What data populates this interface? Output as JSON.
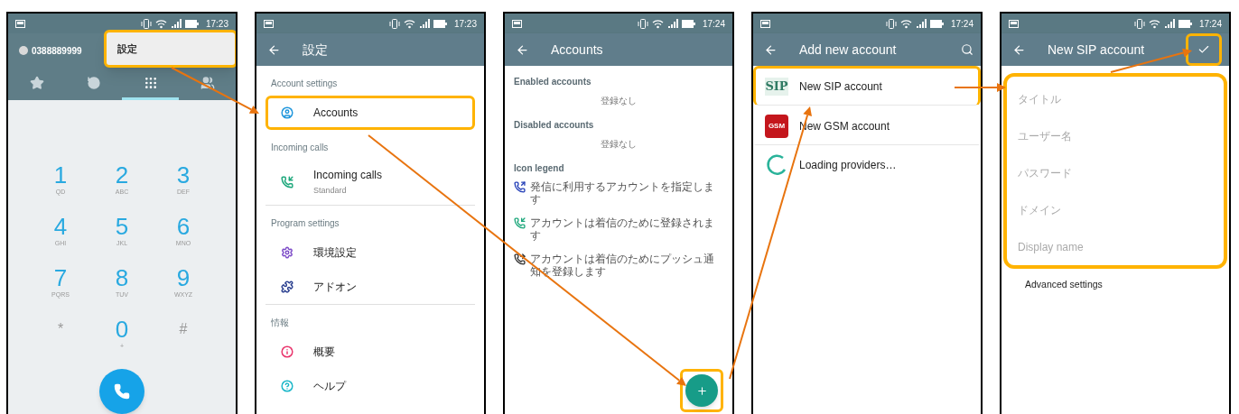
{
  "panels": [
    {
      "kind": "dialer",
      "status_time": "17:23",
      "account_number": "0388889999",
      "menu": {
        "items": [
          "設定"
        ],
        "highlighted": true
      },
      "tabs": [
        {
          "selected": false
        },
        {
          "selected": false
        },
        {
          "selected": true
        },
        {
          "selected": false
        }
      ],
      "keys": [
        {
          "digit": "1",
          "letters": "QD"
        },
        {
          "digit": "2",
          "letters": "ABC"
        },
        {
          "digit": "3",
          "letters": "DEF"
        },
        {
          "digit": "4",
          "letters": "GHI"
        },
        {
          "digit": "5",
          "letters": "JKL"
        },
        {
          "digit": "6",
          "letters": "MNO"
        },
        {
          "digit": "7",
          "letters": "PQRS"
        },
        {
          "digit": "8",
          "letters": "TUV"
        },
        {
          "digit": "9",
          "letters": "WXYZ"
        },
        {
          "digit": "*"
        },
        {
          "digit": "0",
          "letters": "+"
        },
        {
          "digit": "#"
        }
      ]
    },
    {
      "kind": "settings",
      "status_time": "17:23",
      "title": "設定",
      "sections": [
        {
          "heading": "Account settings",
          "items": [
            {
              "kind": "account",
              "label": "Accounts",
              "highlighted": true
            }
          ]
        },
        {
          "heading": "Incoming calls",
          "items": [
            {
              "kind": "incoming",
              "label": "Incoming calls",
              "sublabel": "Standard",
              "highlighted": false
            }
          ]
        },
        {
          "heading": "Program settings",
          "items": [
            {
              "kind": "gear",
              "label": "環境設定",
              "highlighted": false
            },
            {
              "kind": "addon",
              "label": "アドオン",
              "highlighted": false
            }
          ]
        },
        {
          "heading": "情報",
          "items": [
            {
              "kind": "info",
              "label": "概要",
              "highlighted": false
            },
            {
              "kind": "help",
              "label": "ヘルプ",
              "highlighted": false
            }
          ]
        }
      ]
    },
    {
      "kind": "accounts",
      "status_time": "17:24",
      "title": "Accounts",
      "groups": [
        {
          "heading": "Enabled accounts",
          "empty_text": "登録なし"
        },
        {
          "heading": "Disabled accounts",
          "empty_text": "登録なし"
        }
      ],
      "legend": {
        "heading": "Icon legend",
        "items": [
          {
            "kind": "outgoing",
            "text": "発信に利用するアカウントを指定します"
          },
          {
            "kind": "incoming",
            "text": "アカウントは着信のために登録されます"
          },
          {
            "kind": "push",
            "text": "アカウントは着信のためにプッシュ通知を登録します"
          }
        ]
      },
      "fab": {
        "highlighted": true
      }
    },
    {
      "kind": "add_account",
      "status_time": "17:24",
      "title": "Add new account",
      "items": [
        {
          "kind": "sip",
          "logo_text": "SIP",
          "label": "New SIP account",
          "highlighted": true
        },
        {
          "kind": "gsm",
          "logo_text": "GSM",
          "label": "New GSM account",
          "highlighted": false
        },
        {
          "kind": "loading",
          "label": "Loading providers…",
          "highlighted": false
        }
      ]
    },
    {
      "kind": "sip_form",
      "status_time": "17:24",
      "title": "New SIP account",
      "confirm_highlighted": true,
      "fields": {
        "highlighted": true,
        "placeholders": [
          "タイトル",
          "ユーザー名",
          "パスワード",
          "ドメイン",
          "Display name"
        ]
      },
      "advanced_label": "Advanced settings"
    }
  ]
}
